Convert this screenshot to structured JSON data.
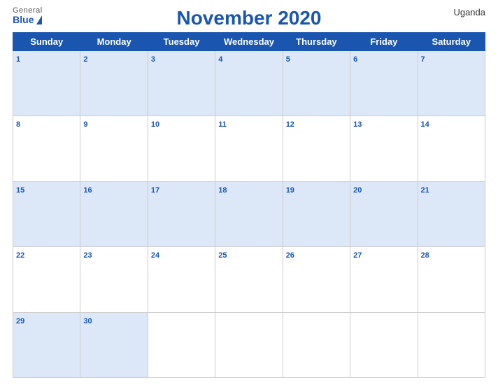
{
  "logo": {
    "general": "General",
    "blue": "Blue"
  },
  "header": {
    "title": "November 2020",
    "country": "Uganda"
  },
  "weekdays": [
    "Sunday",
    "Monday",
    "Tuesday",
    "Wednesday",
    "Thursday",
    "Friday",
    "Saturday"
  ],
  "weeks": [
    [
      {
        "day": 1,
        "empty": false
      },
      {
        "day": 2,
        "empty": false
      },
      {
        "day": 3,
        "empty": false
      },
      {
        "day": 4,
        "empty": false
      },
      {
        "day": 5,
        "empty": false
      },
      {
        "day": 6,
        "empty": false
      },
      {
        "day": 7,
        "empty": false
      }
    ],
    [
      {
        "day": 8,
        "empty": false
      },
      {
        "day": 9,
        "empty": false
      },
      {
        "day": 10,
        "empty": false
      },
      {
        "day": 11,
        "empty": false
      },
      {
        "day": 12,
        "empty": false
      },
      {
        "day": 13,
        "empty": false
      },
      {
        "day": 14,
        "empty": false
      }
    ],
    [
      {
        "day": 15,
        "empty": false
      },
      {
        "day": 16,
        "empty": false
      },
      {
        "day": 17,
        "empty": false
      },
      {
        "day": 18,
        "empty": false
      },
      {
        "day": 19,
        "empty": false
      },
      {
        "day": 20,
        "empty": false
      },
      {
        "day": 21,
        "empty": false
      }
    ],
    [
      {
        "day": 22,
        "empty": false
      },
      {
        "day": 23,
        "empty": false
      },
      {
        "day": 24,
        "empty": false
      },
      {
        "day": 25,
        "empty": false
      },
      {
        "day": 26,
        "empty": false
      },
      {
        "day": 27,
        "empty": false
      },
      {
        "day": 28,
        "empty": false
      }
    ],
    [
      {
        "day": 29,
        "empty": false
      },
      {
        "day": 30,
        "empty": false
      },
      {
        "day": null,
        "empty": true
      },
      {
        "day": null,
        "empty": true
      },
      {
        "day": null,
        "empty": true
      },
      {
        "day": null,
        "empty": true
      },
      {
        "day": null,
        "empty": true
      }
    ]
  ]
}
